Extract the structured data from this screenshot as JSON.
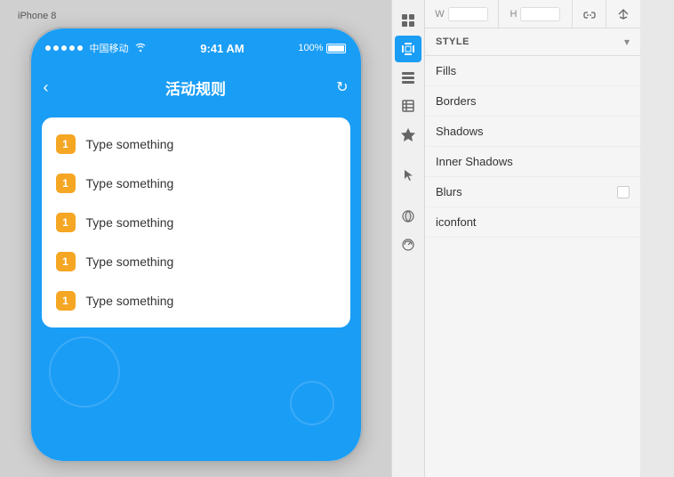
{
  "device": {
    "label": "iPhone 8",
    "status_bar": {
      "dots": [
        1,
        2,
        3,
        4,
        5
      ],
      "carrier": "中国移动",
      "wifi": "📶",
      "time": "9:41 AM",
      "battery_percent": "100%"
    },
    "nav": {
      "back_icon": "‹",
      "title": "活动规则",
      "refresh_icon": "↻"
    }
  },
  "list_items": [
    {
      "badge": "1",
      "text": "Type something"
    },
    {
      "badge": "1",
      "text": "Type something"
    },
    {
      "badge": "1",
      "text": "Type something"
    },
    {
      "badge": "1",
      "text": "Type something"
    },
    {
      "badge": "1",
      "text": "Type something"
    }
  ],
  "toolbar": {
    "tools": [
      {
        "icon": "⬛",
        "name": "grid-2x2",
        "active": false
      },
      {
        "icon": "⬜",
        "name": "frame",
        "active": true
      },
      {
        "icon": "☰",
        "name": "grid-rows",
        "active": false
      },
      {
        "icon": "▣",
        "name": "component",
        "active": false
      },
      {
        "icon": "★",
        "name": "symbol",
        "active": false
      },
      {
        "icon": "🖐",
        "name": "pointer",
        "active": false
      },
      {
        "icon": "◯",
        "name": "style",
        "active": false
      },
      {
        "icon": "◔",
        "name": "prototype",
        "active": false
      }
    ]
  },
  "inspector": {
    "dimensions": {
      "w_label": "W",
      "h_label": "H",
      "w_value": "",
      "h_value": "",
      "icon1": "⊿",
      "icon2": "▷"
    },
    "style_section": {
      "label": "STYLE",
      "chevron": "▾"
    },
    "style_items": [
      {
        "label": "Fills",
        "has_checkbox": false
      },
      {
        "label": "Borders",
        "has_checkbox": false
      },
      {
        "label": "Shadows",
        "has_checkbox": false
      },
      {
        "label": "Inner Shadows",
        "has_checkbox": false
      },
      {
        "label": "Blurs",
        "has_checkbox": true
      },
      {
        "label": "iconfont",
        "has_checkbox": false
      }
    ]
  }
}
